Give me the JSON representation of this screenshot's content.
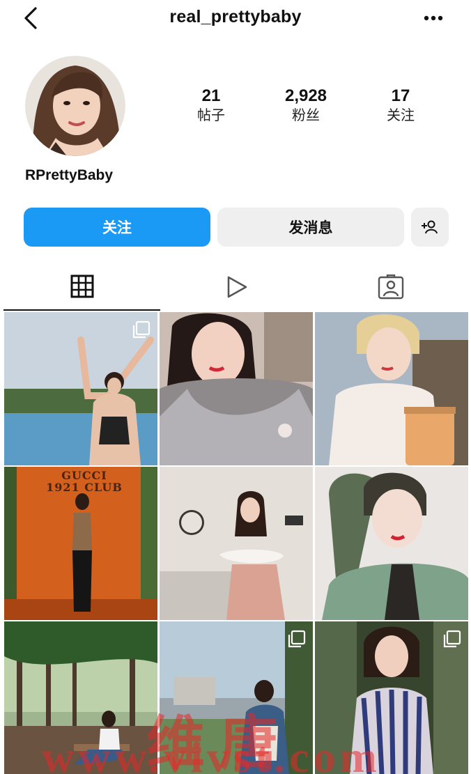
{
  "header": {
    "username": "real_prettybaby",
    "back_icon": "chevron-left-icon",
    "more_icon": "more-horizontal-icon"
  },
  "profile": {
    "display_name": "RPrettyBaby",
    "stats": [
      {
        "value": "21",
        "label": "帖子"
      },
      {
        "value": "2,928",
        "label": "粉丝"
      },
      {
        "value": "17",
        "label": "关注"
      }
    ]
  },
  "actions": {
    "follow_label": "关注",
    "message_label": "发消息",
    "add_user_icon": "add-person-icon"
  },
  "tabs": [
    {
      "icon": "grid-icon",
      "active": true
    },
    {
      "icon": "reels-play-icon",
      "active": false
    },
    {
      "icon": "tagged-person-icon",
      "active": false
    }
  ],
  "posts": [
    {
      "subject": "woman arms raised at infinity pool",
      "multi": true
    },
    {
      "subject": "woman in sparkly dress with fur scarf",
      "multi": false
    },
    {
      "subject": "woman with blonde short hair at cafe",
      "multi": false
    },
    {
      "subject": "woman standing in front of orange wall",
      "multi": false,
      "sign_text": "GUCCI 1921 CLUB"
    },
    {
      "subject": "woman in off-shoulder top in hotel room",
      "multi": false
    },
    {
      "subject": "woman with green ponytail in green blazer",
      "multi": false
    },
    {
      "subject": "woman sitting on bench in forest",
      "multi": false
    },
    {
      "subject": "woman outdoors near buildings",
      "multi": true
    },
    {
      "subject": "woman in striped blouse in forest",
      "multi": true
    }
  ],
  "watermark": {
    "line1": "维 唐",
    "line2": "www.vivst.com"
  },
  "colors": {
    "accent": "#1a9af5",
    "button_bg": "#efefef",
    "text": "#111111"
  }
}
